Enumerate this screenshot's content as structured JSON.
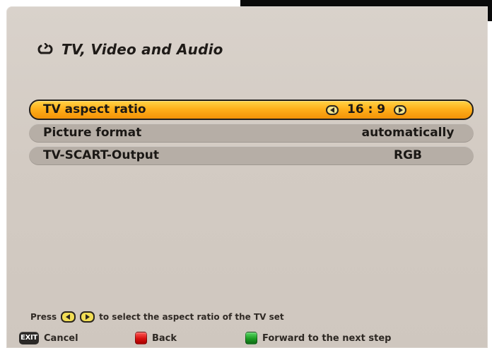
{
  "window": {
    "title": "TV, Video and Audio",
    "title_icon": "back-arrow-icon",
    "colors": {
      "panel_background": "#d3cbc3",
      "row_background": "#b6aea6",
      "selected_row": "#ffb01b",
      "text": "#1b1815",
      "arrow_button": "#f2e58c"
    }
  },
  "menu": {
    "rows": [
      {
        "label": "TV aspect ratio",
        "value": "16 : 9",
        "selected": true
      },
      {
        "label": "Picture format",
        "value": "automatically",
        "selected": false
      },
      {
        "label": "TV-SCART-Output",
        "value": "RGB",
        "selected": false
      }
    ]
  },
  "help": {
    "prefix": "Press",
    "suffix": "to select the aspect ratio of the TV set",
    "left_key_icon": "left-arrow-key-icon",
    "right_key_icon": "right-arrow-key-icon"
  },
  "footer": {
    "exit": {
      "key": "EXIT",
      "label": "Cancel",
      "icon": "exit-key-icon"
    },
    "back": {
      "label": "Back",
      "icon": "red-key-icon",
      "color": "#d7100f"
    },
    "forward": {
      "label": "Forward to the next step",
      "icon": "green-key-icon",
      "color": "#1b9d23"
    }
  }
}
